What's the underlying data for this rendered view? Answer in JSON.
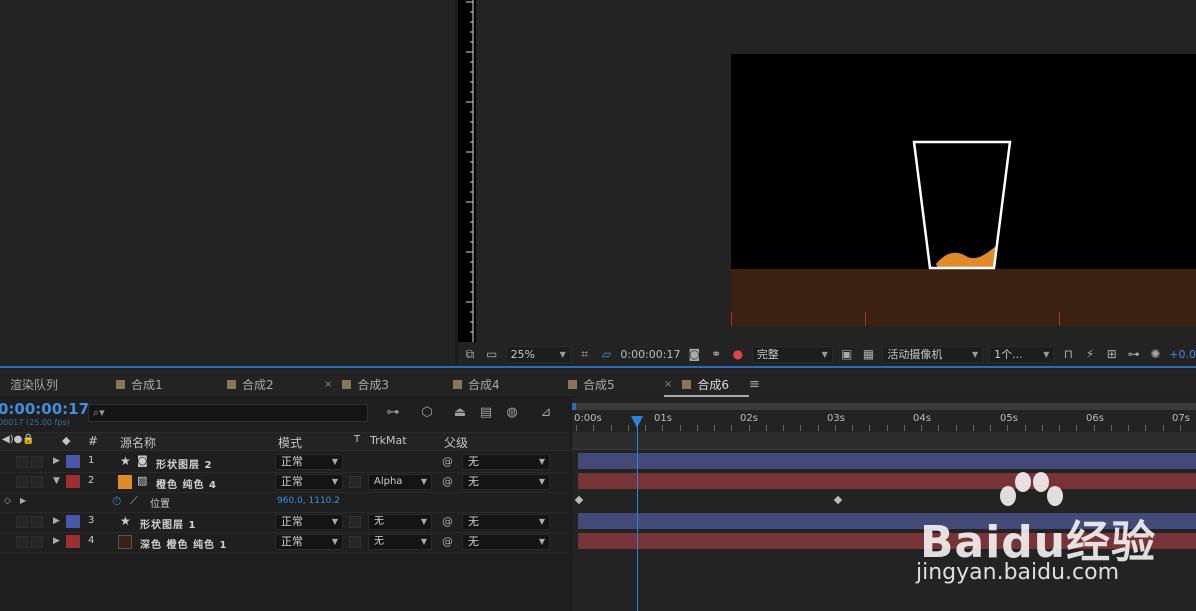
{
  "viewer_toolbar": {
    "zoom": "25%",
    "timecode": "0:00:00:17",
    "resolution": "完整",
    "camera": "活动摄像机",
    "views": "1个...",
    "exposure": "+0.0"
  },
  "tabs": [
    {
      "label": "渲染队列",
      "swatch": false,
      "active": false
    },
    {
      "label": "合成1",
      "swatch": true,
      "active": false
    },
    {
      "label": "合成2",
      "swatch": true,
      "active": false
    },
    {
      "label": "合成3",
      "swatch": true,
      "active": false,
      "close": "×"
    },
    {
      "label": "合成4",
      "swatch": true,
      "active": false
    },
    {
      "label": "合成5",
      "swatch": true,
      "active": false
    },
    {
      "label": "合成6",
      "swatch": true,
      "active": true,
      "close": "×"
    }
  ],
  "tab_menu": "≡",
  "timeline": {
    "current_time": "0:00:00:17",
    "frame_info": "00017 (25.00 fps)",
    "search_placeholder": "⌕▾",
    "columns": {
      "num": "#",
      "source_name": "源名称",
      "mode": "模式",
      "t": "T",
      "trkmat": "TrkMat",
      "parent": "父级"
    },
    "layers": [
      {
        "num": "1",
        "type": "star",
        "name": "形状图层 2",
        "color": "#4a56a8",
        "mode": "正常",
        "trkmat": "",
        "parent": "无",
        "expanded": false
      },
      {
        "num": "2",
        "type": "solid",
        "name": "橙色 纯色 4",
        "color": "#9c3030",
        "mode": "正常",
        "trkmat": "Alpha",
        "parent": "无",
        "expanded": true
      },
      {
        "num": "3",
        "type": "star",
        "name": "形状图层 1",
        "color": "#4a56a8",
        "mode": "正常",
        "trkmat": "无",
        "parent": "无",
        "expanded": false
      },
      {
        "num": "4",
        "type": "solid",
        "name": "深色 橙色 纯色 1",
        "color": "#9c3030",
        "mode": "正常",
        "trkmat": "无",
        "parent": "无",
        "expanded": false
      }
    ],
    "property": {
      "name": "位置",
      "value": "960.0, 1110.2"
    },
    "ruler": [
      "0:00s",
      "01s",
      "02s",
      "03s",
      "04s",
      "05s",
      "06s",
      "07s"
    ]
  },
  "colors": {
    "accent": "#2f80d8",
    "timecode": "#3f8fe0",
    "shape_bar": "#434a77",
    "solid_bar": "#773436",
    "orange_liquid": "#e08a2c",
    "floor": "#3b2111"
  },
  "watermark": {
    "brand": "Baidu经验",
    "url": "jingyan.baidu.com"
  }
}
